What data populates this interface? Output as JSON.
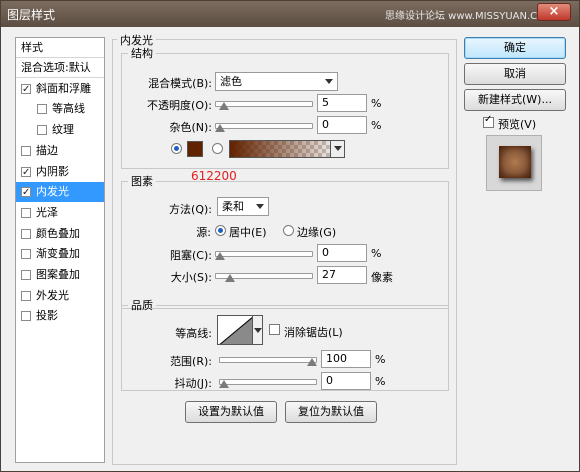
{
  "window": {
    "title": "图层样式",
    "watermark": "思缘设计论坛 www.MISSYUAN.COM"
  },
  "style_list": {
    "header": "样式",
    "items": [
      {
        "label": "混合选项:默认",
        "checkbox": false,
        "checked": false,
        "indent": 0,
        "selected": false
      },
      {
        "label": "斜面和浮雕",
        "checkbox": true,
        "checked": true,
        "indent": 0,
        "selected": false
      },
      {
        "label": "等高线",
        "checkbox": true,
        "checked": false,
        "indent": 1,
        "selected": false
      },
      {
        "label": "纹理",
        "checkbox": true,
        "checked": false,
        "indent": 1,
        "selected": false
      },
      {
        "label": "描边",
        "checkbox": true,
        "checked": false,
        "indent": 0,
        "selected": false
      },
      {
        "label": "内阴影",
        "checkbox": true,
        "checked": true,
        "indent": 0,
        "selected": false
      },
      {
        "label": "内发光",
        "checkbox": true,
        "checked": true,
        "indent": 0,
        "selected": true
      },
      {
        "label": "光泽",
        "checkbox": true,
        "checked": false,
        "indent": 0,
        "selected": false
      },
      {
        "label": "颜色叠加",
        "checkbox": true,
        "checked": false,
        "indent": 0,
        "selected": false
      },
      {
        "label": "渐变叠加",
        "checkbox": true,
        "checked": false,
        "indent": 0,
        "selected": false
      },
      {
        "label": "图案叠加",
        "checkbox": true,
        "checked": false,
        "indent": 0,
        "selected": false
      },
      {
        "label": "外发光",
        "checkbox": true,
        "checked": false,
        "indent": 0,
        "selected": false
      },
      {
        "label": "投影",
        "checkbox": true,
        "checked": false,
        "indent": 0,
        "selected": false
      }
    ]
  },
  "panel": {
    "title": "内发光",
    "structure": {
      "title": "结构",
      "blend_mode_label": "混合模式(B):",
      "blend_mode_value": "滤色",
      "opacity_label": "不透明度(O):",
      "opacity_value": "5",
      "opacity_unit": "%",
      "opacity_fraction": 0.05,
      "noise_label": "杂色(N):",
      "noise_value": "0",
      "noise_unit": "%",
      "noise_fraction": 0.0,
      "glow_color": "#612200"
    },
    "elements": {
      "title": "图素",
      "annotation": "612200",
      "method_label": "方法(Q):",
      "method_value": "柔和",
      "source_label": "源:",
      "source_center": "居中(E)",
      "source_edge": "边缘(G)",
      "choke_label": "阻塞(C):",
      "choke_value": "0",
      "choke_unit": "%",
      "choke_fraction": 0.0,
      "size_label": "大小(S):",
      "size_value": "27",
      "size_unit": "像素",
      "size_fraction": 0.108
    },
    "quality": {
      "title": "品质",
      "contour_label": "等高线:",
      "antialias_label": "消除锯齿(L)",
      "range_label": "范围(R):",
      "range_value": "100",
      "range_unit": "%",
      "range_fraction": 1.0,
      "jitter_label": "抖动(J):",
      "jitter_value": "0",
      "jitter_unit": "%",
      "jitter_fraction": 0.0
    },
    "make_default": "设置为默认值",
    "reset_default": "复位为默认值"
  },
  "buttons": {
    "ok": "确定",
    "cancel": "取消",
    "new_style": "新建样式(W)...",
    "preview": "预览(V)"
  }
}
